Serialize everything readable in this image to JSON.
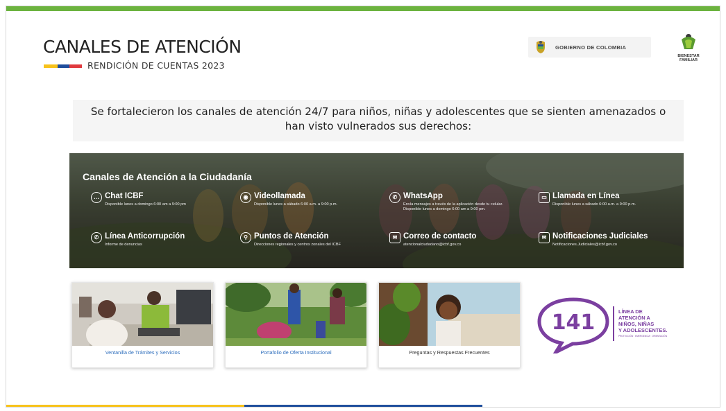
{
  "header": {
    "title": "CANALES DE ATENCIÓN",
    "subtitle": "RENDICIÓN DE CUENTAS 2023",
    "government_label": "GOBIERNO DE COLOMBIA",
    "logo_text_line1": "BIENESTAR",
    "logo_text_line2": "FAMILIAR"
  },
  "intro_text": "Se fortalecieron los canales de atención 24/7 para niños, niñas y adolescentes  que se sienten amenazados o han visto vulnerados sus derechos:",
  "banner": {
    "title": "Canales de Atención a la Ciudadanía",
    "channels": [
      {
        "name": "Chat ICBF",
        "desc": "Disponible lunes a domingo 6:00 am a 9:00 pm",
        "icon": "chat-icon"
      },
      {
        "name": "Videollamada",
        "desc": "Disponible lunes a sábado 6:00 a.m. a 9:00 p.m.",
        "icon": "video-call-icon"
      },
      {
        "name": "WhatsApp",
        "desc": "Envía mensajes a través de la aplicación desde tu celular. Disponible lunes a domingo 6:00 am a 9:00 pm.",
        "icon": "whatsapp-icon"
      },
      {
        "name": "Llamada en Línea",
        "desc": "Disponible lunes a sábado 6:00 a.m. a 9:00 p.m.",
        "icon": "monitor-icon"
      },
      {
        "name": "Línea Anticorrupción",
        "desc": "Informe de denuncias",
        "icon": "phone-icon"
      },
      {
        "name": "Puntos de Atención",
        "desc": "Direcciones regionales y centros zonales del ICBF",
        "icon": "location-pin-icon"
      },
      {
        "name": "Correo de contacto",
        "desc": "atencionalciudadano@icbf.gov.co",
        "icon": "mail-icon"
      },
      {
        "name": "Notificaciones Judiciales",
        "desc": "Notificaciones.Judiciales@icbf.gov.co",
        "icon": "mail-icon"
      }
    ]
  },
  "cards": [
    {
      "label": "Ventanilla de Trámites y Servicios"
    },
    {
      "label": "Portafolio de Oferta Institucional"
    },
    {
      "label": "Preguntas y Respuestas Frecuentes"
    }
  ],
  "line141": {
    "number": "141",
    "line1": "LÍNEA DE",
    "line2": "ATENCIÓN A",
    "line3": "NIÑOS, NIÑAS",
    "line4": "Y ADOLESCENTES.",
    "tagline": "PROTECCIÓN · EMERGENCIA · ORIENTACIÓN"
  },
  "colors": {
    "green_bar": "#6cb33f",
    "flag_yellow": "#f7c21b",
    "flag_blue": "#1f4e9c",
    "flag_red": "#e03a3e",
    "purple_141": "#7b3fa0",
    "link_blue": "#2f6fbd"
  }
}
